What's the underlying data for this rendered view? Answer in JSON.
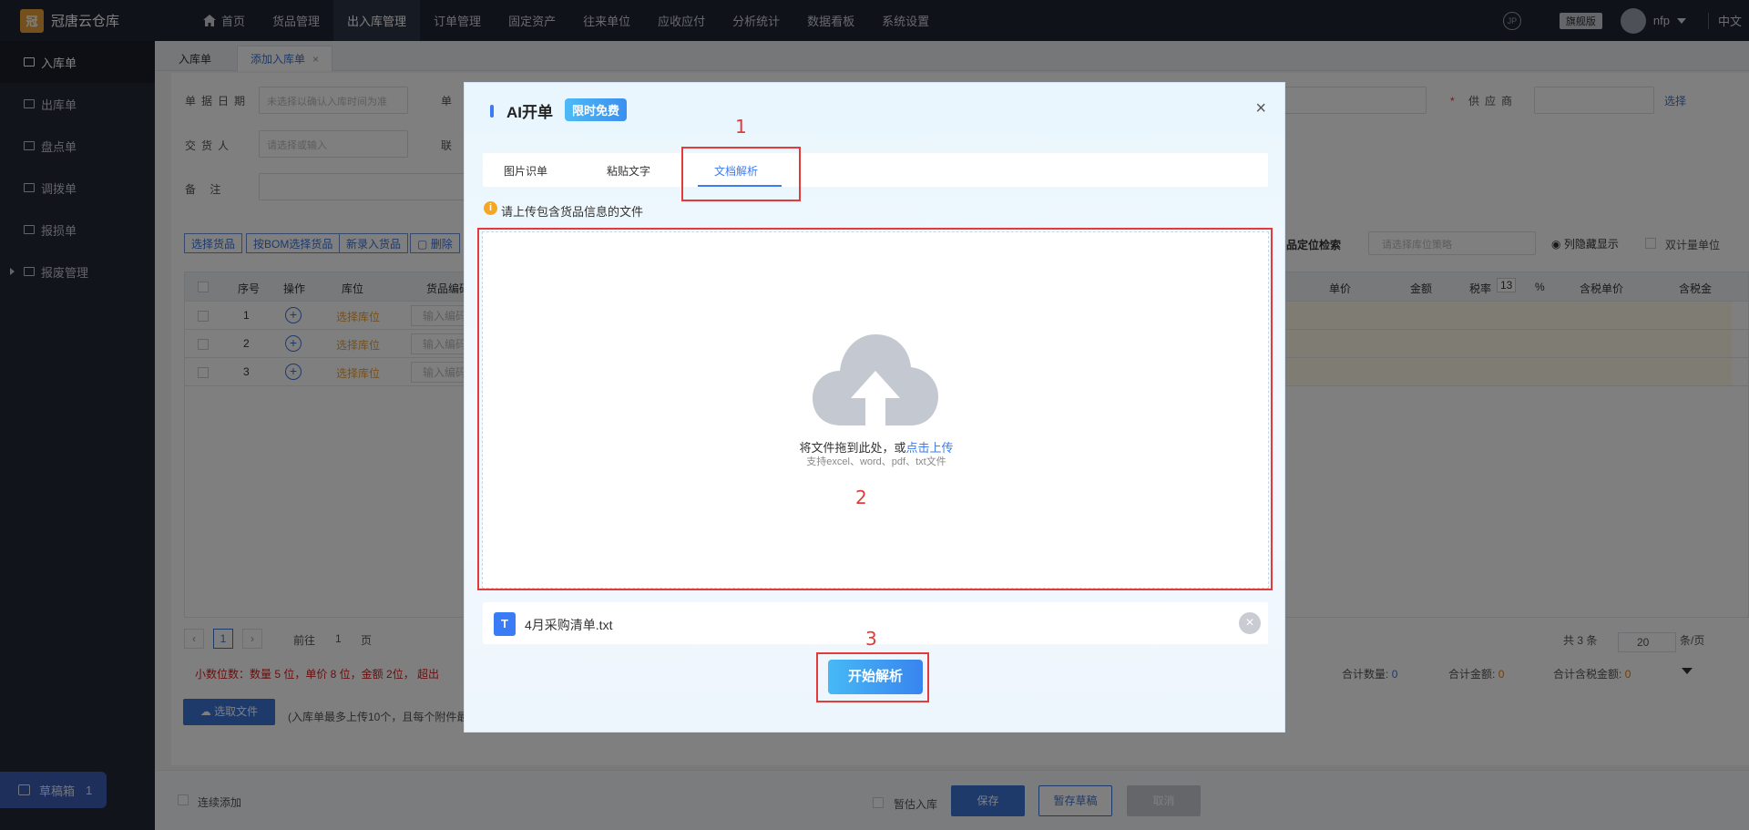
{
  "app": {
    "logo_mark": "冠",
    "name": "冠唐云仓库"
  },
  "nav": {
    "items": [
      "首页",
      "货品管理",
      "出入库管理",
      "订单管理",
      "固定资产",
      "往来单位",
      "应收应付",
      "分析统计",
      "数据看板",
      "系统设置"
    ],
    "active_index": 2
  },
  "top_right": {
    "round_icon": "JP",
    "edition": "旗舰版",
    "user": "nfp",
    "language": "中文"
  },
  "sidebar": {
    "items": [
      "入库单",
      "出库单",
      "盘点单",
      "调拨单",
      "报损单",
      "报废管理"
    ],
    "draft_label": "草稿箱",
    "draft_count": "1"
  },
  "page_tabs": {
    "tab1": "入库单",
    "tab2": "添加入库单",
    "tab2_close": "×"
  },
  "form": {
    "date_label": "单据日期",
    "date_placeholder": "未选择以确认入库时间为准",
    "doc_label": "单",
    "supplier_label": "供应商",
    "supplier_link": "选择",
    "deliverer_label": "交货人",
    "deliverer_placeholder": "请选择或输入",
    "contact_label": "联",
    "remark_label": "备 注"
  },
  "toolbar": {
    "select_goods": "选择货品",
    "bom_select": "按BOM选择货品",
    "new_goods": "新录入货品",
    "delete": "删除",
    "locate_search": "品定位检索",
    "location_strategy": "请选择库位策略",
    "toggle_cols": "列隐藏显示",
    "dual_unit": "双计量单位"
  },
  "grid": {
    "headers": {
      "seq": "序号",
      "op": "操作",
      "loc": "库位",
      "code": "货品编码",
      "price": "单价",
      "amount": "金额",
      "tax": "税率",
      "tax_value": "13",
      "pct": "%",
      "tax_price": "含税单价",
      "tax_amount": "含税金"
    },
    "rows": [
      {
        "seq": "1",
        "loc": "选择库位",
        "code": "输入编码"
      },
      {
        "seq": "2",
        "loc": "选择库位",
        "code": "输入编码"
      },
      {
        "seq": "3",
        "loc": "选择库位",
        "code": "输入编码"
      }
    ]
  },
  "pager": {
    "current": "1",
    "goto_label": "前往",
    "goto_value": "1",
    "page_unit": "页",
    "total": "共 3 条",
    "page_size": "20",
    "per_page": "条/页"
  },
  "footer": {
    "decimals_note": "小数位数：数量 5 位，单价 8 位，金额 2位， 超出",
    "total_qty_label": "合计数量:",
    "total_qty": "0",
    "total_amount_label": "合计金额:",
    "total_amount": "0",
    "total_tax_label": "合计含税金额:",
    "total_tax": "0",
    "upload_btn": "选取文件",
    "upload_note": "(入库单最多上传10个，且每个附件最"
  },
  "bottom": {
    "continue_add": "连续添加",
    "tentative": "暂估入库",
    "save": "保存",
    "save_draft": "暂存草稿",
    "cancel": "取消"
  },
  "dialog": {
    "title": "AI开单",
    "badge": "限时免费",
    "close": "×",
    "tabs": [
      "图片识单",
      "粘贴文字",
      "文档解析"
    ],
    "active_tab": 2,
    "hint_icon": "i",
    "hint": "请上传包含货品信息的文件",
    "drop_text": "将文件拖到此处，或",
    "drop_link": "点击上传",
    "drop_sub": "支持excel、word、pdf、txt文件",
    "file_icon": "T",
    "file_name": "4月采购清单.txt",
    "file_remove": "×",
    "start_btn": "开始解析"
  },
  "annotations": [
    "1",
    "2",
    "3"
  ],
  "colors": {
    "accent": "#3c7bf0",
    "annotation": "#e33a3a",
    "topbar": "#1f2532",
    "sidebar": "#222836"
  }
}
